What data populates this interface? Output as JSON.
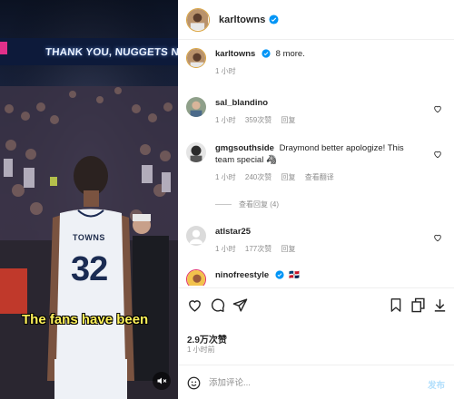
{
  "media": {
    "banner_text": "THANK YOU, NUGGETS NATION",
    "jersey_name": "TOWNS",
    "jersey_number": "32",
    "caption": "The fans have been",
    "mute_icon": "speaker-muted-icon"
  },
  "post": {
    "author": "karltowns",
    "verified": true
  },
  "caption_row": {
    "username": "karltowns",
    "text": "8 more.",
    "time": "1 小时"
  },
  "comments": [
    {
      "username": "sal_blandino",
      "text": "",
      "time": "1 小时",
      "likes": "359次赞",
      "reply": "回复",
      "translate": ""
    },
    {
      "username": "gmgsouthside",
      "text": "Draymond better apologize! This team special 🦓",
      "time": "1 小时",
      "likes": "240次赞",
      "reply": "回复",
      "translate": "查看翻译",
      "view_replies": "查看回复 (4)"
    },
    {
      "username": "atlstar25",
      "text": "",
      "time": "1 小时",
      "likes": "177次赞",
      "reply": "回复",
      "translate": ""
    },
    {
      "username": "ninofreestyle",
      "text": "🇩🇴",
      "time": "",
      "likes": "",
      "reply": "",
      "translate": ""
    }
  ],
  "actions": {
    "like_icon": "heart-icon",
    "comment_icon": "comment-icon",
    "share_icon": "paper-plane-icon",
    "save_icon": "bookmark-icon",
    "copy_icon": "copy-icon",
    "download_icon": "download-icon"
  },
  "likes_count": "2.9万次赞",
  "posted_time": "1 小时前",
  "composer": {
    "placeholder": "添加评论...",
    "post_label": "发布"
  },
  "colors": {
    "verified": "#0095f6",
    "post_button_disabled": "#b2dffc",
    "secondary_text": "#8e8e8e"
  }
}
